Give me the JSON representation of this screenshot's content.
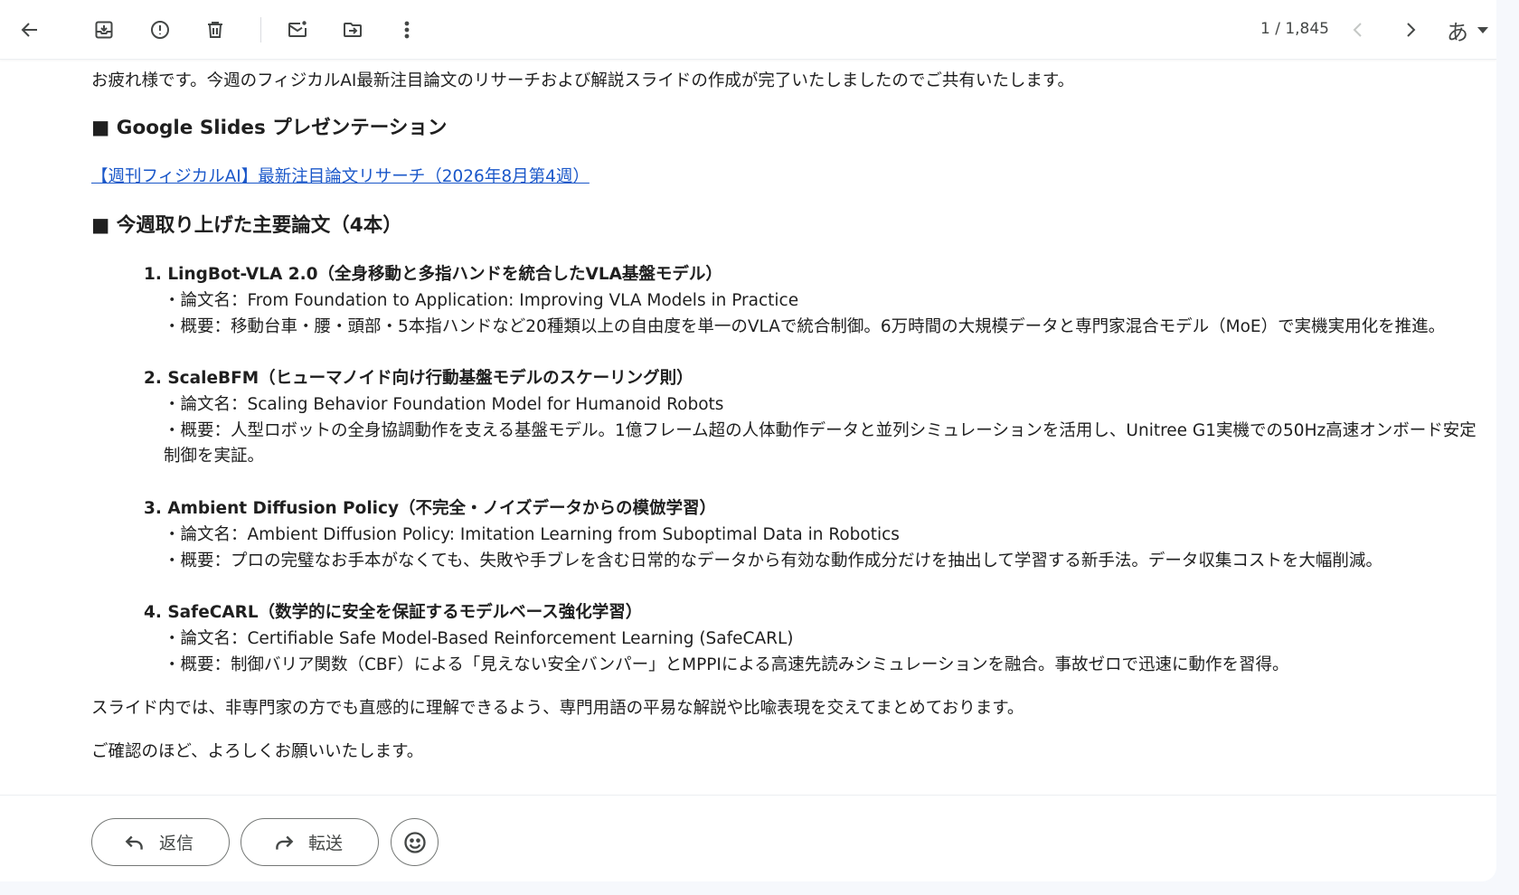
{
  "toolbar": {
    "counter": "1 / 1,845",
    "ime_label": "あ",
    "icons": [
      "back-arrow-icon",
      "archive-icon",
      "report-spam-icon",
      "delete-icon",
      "mark-unread-icon",
      "move-to-icon",
      "more-vert-icon",
      "chevron-left-icon",
      "chevron-right-icon"
    ]
  },
  "email": {
    "greeting": "お疲れ様です。今週のフィジカルAI最新注目論文のリサーチおよび解説スライドの作成が完了いたしましたのでご共有いたします。",
    "slides_heading": "■ Google Slides プレゼンテーション",
    "slides_link": "【週刊フィジカルAI】最新注目論文リサーチ（2026年8月第4週）",
    "papers_heading": "■ 今週取り上げた主要論文（4本）",
    "papers": [
      {
        "title": "1. LingBot-VLA 2.0（全身移動と多指ハンドを統合したVLA基盤モデル）",
        "name": "・論文名：From Foundation to Application: Improving VLA Models in Practice",
        "summary": "・概要：移動台車・腰・頭部・5本指ハンドなど20種類以上の自由度を単一のVLAで統合制御。6万時間の大規模データと専門家混合モデル（MoE）で実機実用化を推進。"
      },
      {
        "title": "2. ScaleBFM（ヒューマノイド向け行動基盤モデルのスケーリング則）",
        "name": "・論文名：Scaling Behavior Foundation Model for Humanoid Robots",
        "summary": "・概要：人型ロボットの全身協調動作を支える基盤モデル。1億フレーム超の人体動作データと並列シミュレーションを活用し、Unitree G1実機での50Hz高速オンボード安定制御を実証。"
      },
      {
        "title": "3. Ambient Diffusion Policy（不完全・ノイズデータからの模倣学習）",
        "name": "・論文名：Ambient Diffusion Policy: Imitation Learning from Suboptimal Data in Robotics",
        "summary": "・概要：プロの完璧なお手本がなくても、失敗や手ブレを含む日常的なデータから有効な動作成分だけを抽出して学習する新手法。データ収集コストを大幅削減。"
      },
      {
        "title": "4. SafeCARL（数学的に安全を保証するモデルベース強化学習）",
        "name": "・論文名：Certifiable Safe Model-Based Reinforcement Learning (SafeCARL)",
        "summary": "・概要：制御バリア関数（CBF）による「見えない安全バンパー」とMPPIによる高速先読みシミュレーションを融合。事故ゼロで迅速に動作を習得。"
      }
    ],
    "closing1": "スライド内では、非専門家の方でも直感的に理解できるよう、専門用語の平易な解説や比喩表現を交えてまとめております。",
    "closing2": "ご確認のほど、よろしくお願いいたします。"
  },
  "actions": {
    "reply_label": "返信",
    "forward_label": "転送"
  }
}
